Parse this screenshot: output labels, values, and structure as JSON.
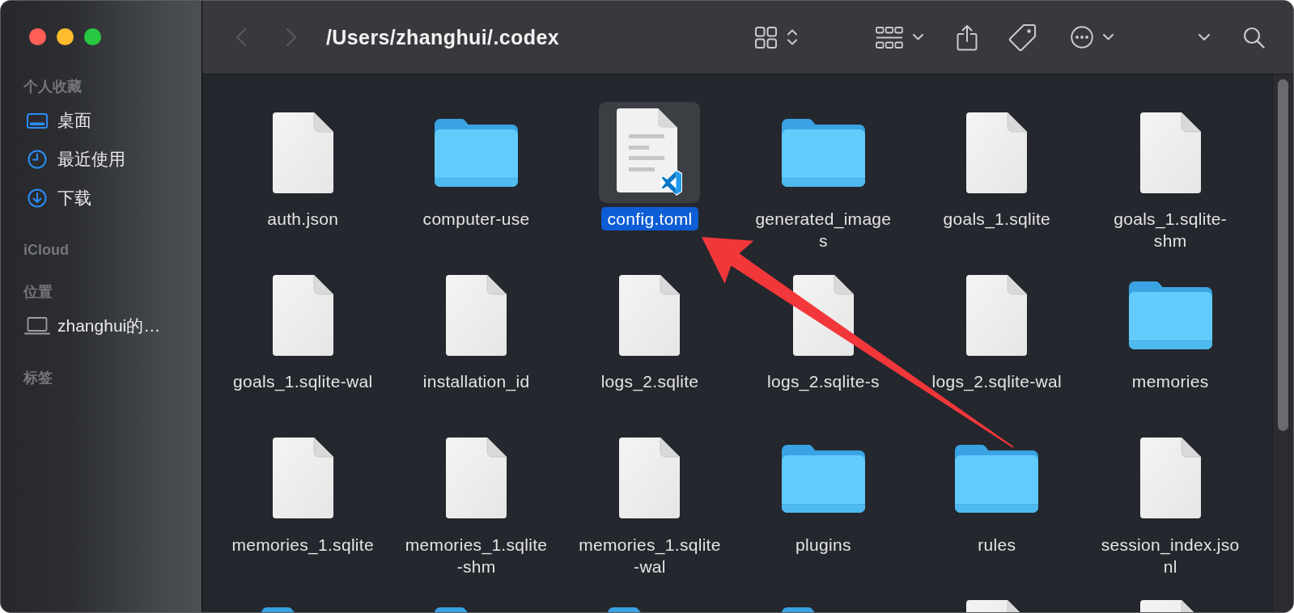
{
  "window": {
    "traffic_lights": [
      {
        "color": "#fe5f57"
      },
      {
        "color": "#febc2e"
      },
      {
        "color": "#28c840"
      }
    ]
  },
  "sidebar": {
    "sections": [
      {
        "title": "个人收藏",
        "items": [
          {
            "label": "桌面",
            "kind": "desktop",
            "selected": false
          },
          {
            "label": "最近使用",
            "kind": "recents",
            "selected": false
          },
          {
            "label": "下载",
            "kind": "downloads",
            "selected": false
          }
        ]
      },
      {
        "title": "iCloud"
      },
      {
        "title": "位置",
        "items": [
          {
            "label": "zhanghui的…",
            "kind": "computer",
            "selected": false
          }
        ]
      },
      {
        "title": "标签"
      }
    ]
  },
  "toolbar": {
    "back": {
      "disabled": true
    },
    "forward": {
      "disabled": true
    },
    "title": "/Users/zhanghui/.codex",
    "buttons": [
      {
        "kind": "view"
      },
      {
        "kind": "group"
      },
      {
        "kind": "share"
      },
      {
        "kind": "tag"
      },
      {
        "kind": "more"
      },
      {
        "kind": "overflow"
      },
      {
        "kind": "search"
      }
    ]
  },
  "grid": {
    "items": [
      {
        "kind": "file",
        "label_lines": [
          "auth.json"
        ],
        "selected": false
      },
      {
        "kind": "folder",
        "label_lines": [
          "computer-use"
        ],
        "selected": false
      },
      {
        "kind": "text",
        "label_lines": [
          "config.toml"
        ],
        "selected": true
      },
      {
        "kind": "folder",
        "label_lines": [
          "generated_image",
          "s"
        ],
        "selected": false
      },
      {
        "kind": "file",
        "label_lines": [
          "goals_1.sqlite"
        ],
        "selected": false
      },
      {
        "kind": "file",
        "label_lines": [
          "goals_1.sqlite-",
          "shm"
        ],
        "selected": false
      },
      {
        "kind": "file",
        "label_lines": [
          "goals_1.sqlite-wal"
        ],
        "selected": false
      },
      {
        "kind": "file",
        "label_lines": [
          "installation_id"
        ],
        "selected": false
      },
      {
        "kind": "file",
        "label_lines": [
          "logs_2.sqlite"
        ],
        "selected": false
      },
      {
        "kind": "file",
        "label_lines": [
          "logs_2.sqlite-s"
        ],
        "selected": false
      },
      {
        "kind": "file",
        "label_lines": [
          "logs_2.sqlite-wal"
        ],
        "selected": false
      },
      {
        "kind": "folder",
        "label_lines": [
          "memories"
        ],
        "selected": false
      },
      {
        "kind": "file",
        "label_lines": [
          "memories_1.sqlite"
        ],
        "selected": false
      },
      {
        "kind": "file",
        "label_lines": [
          "memories_1.sqlite",
          "-shm"
        ],
        "selected": false
      },
      {
        "kind": "file",
        "label_lines": [
          "memories_1.sqlite",
          "-wal"
        ],
        "selected": false
      },
      {
        "kind": "folder",
        "label_lines": [
          "plugins"
        ],
        "selected": false
      },
      {
        "kind": "folder",
        "label_lines": [
          "rules"
        ],
        "selected": false
      },
      {
        "kind": "file",
        "label_lines": [
          "session_index.jso",
          "nl"
        ],
        "selected": false
      },
      {
        "kind": "folder",
        "selected": false
      },
      {
        "kind": "folder",
        "selected": false
      },
      {
        "kind": "folder",
        "selected": false
      },
      {
        "kind": "folder",
        "selected": false
      },
      {
        "kind": "file",
        "selected": false
      },
      {
        "kind": "file",
        "selected": false
      }
    ]
  },
  "annotations": [
    {
      "kind": "arrow"
    }
  ]
}
